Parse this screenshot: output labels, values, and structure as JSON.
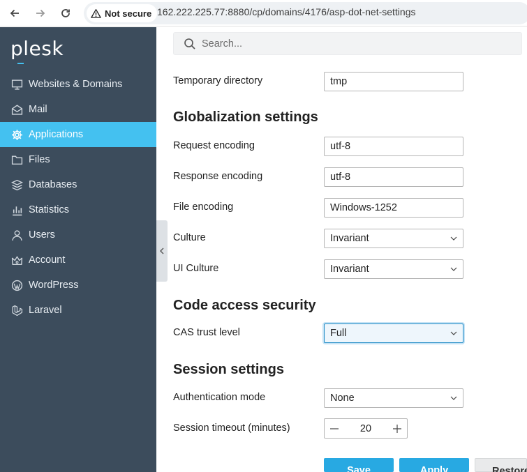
{
  "browser": {
    "security_label": "Not secure",
    "url": "162.222.225.77:8880/cp/domains/4176/asp-dot-net-settings"
  },
  "sidebar": {
    "logo": "plesk",
    "items": [
      {
        "label": "Websites & Domains",
        "icon": "monitor-icon"
      },
      {
        "label": "Mail",
        "icon": "mail-icon"
      },
      {
        "label": "Applications",
        "icon": "gear-icon",
        "active": true
      },
      {
        "label": "Files",
        "icon": "folder-icon"
      },
      {
        "label": "Databases",
        "icon": "database-icon"
      },
      {
        "label": "Statistics",
        "icon": "bar-chart-icon"
      },
      {
        "label": "Users",
        "icon": "user-icon"
      },
      {
        "label": "Account",
        "icon": "crown-icon"
      },
      {
        "label": "WordPress",
        "icon": "wordpress-icon"
      },
      {
        "label": "Laravel",
        "icon": "laravel-icon"
      }
    ]
  },
  "search": {
    "placeholder": "Search..."
  },
  "form": {
    "temp_dir": {
      "label": "Temporary directory",
      "value": "tmp"
    },
    "globalization": {
      "title": "Globalization settings",
      "request_encoding": {
        "label": "Request encoding",
        "value": "utf-8"
      },
      "response_encoding": {
        "label": "Response encoding",
        "value": "utf-8"
      },
      "file_encoding": {
        "label": "File encoding",
        "value": "Windows-1252"
      },
      "culture": {
        "label": "Culture",
        "value": "Invariant"
      },
      "ui_culture": {
        "label": "UI Culture",
        "value": "Invariant"
      }
    },
    "cas": {
      "title": "Code access security",
      "trust_level": {
        "label": "CAS trust level",
        "value": "Full"
      }
    },
    "session": {
      "title": "Session settings",
      "auth_mode": {
        "label": "Authentication mode",
        "value": "None"
      },
      "timeout": {
        "label": "Session timeout (minutes)",
        "value": "20"
      }
    }
  },
  "buttons": {
    "save": "Save",
    "apply": "Apply",
    "restore": "Restore"
  },
  "colors": {
    "sidebar": "#3c4c5c",
    "accent": "#44c1f0",
    "primary_button": "#28a9e2"
  }
}
